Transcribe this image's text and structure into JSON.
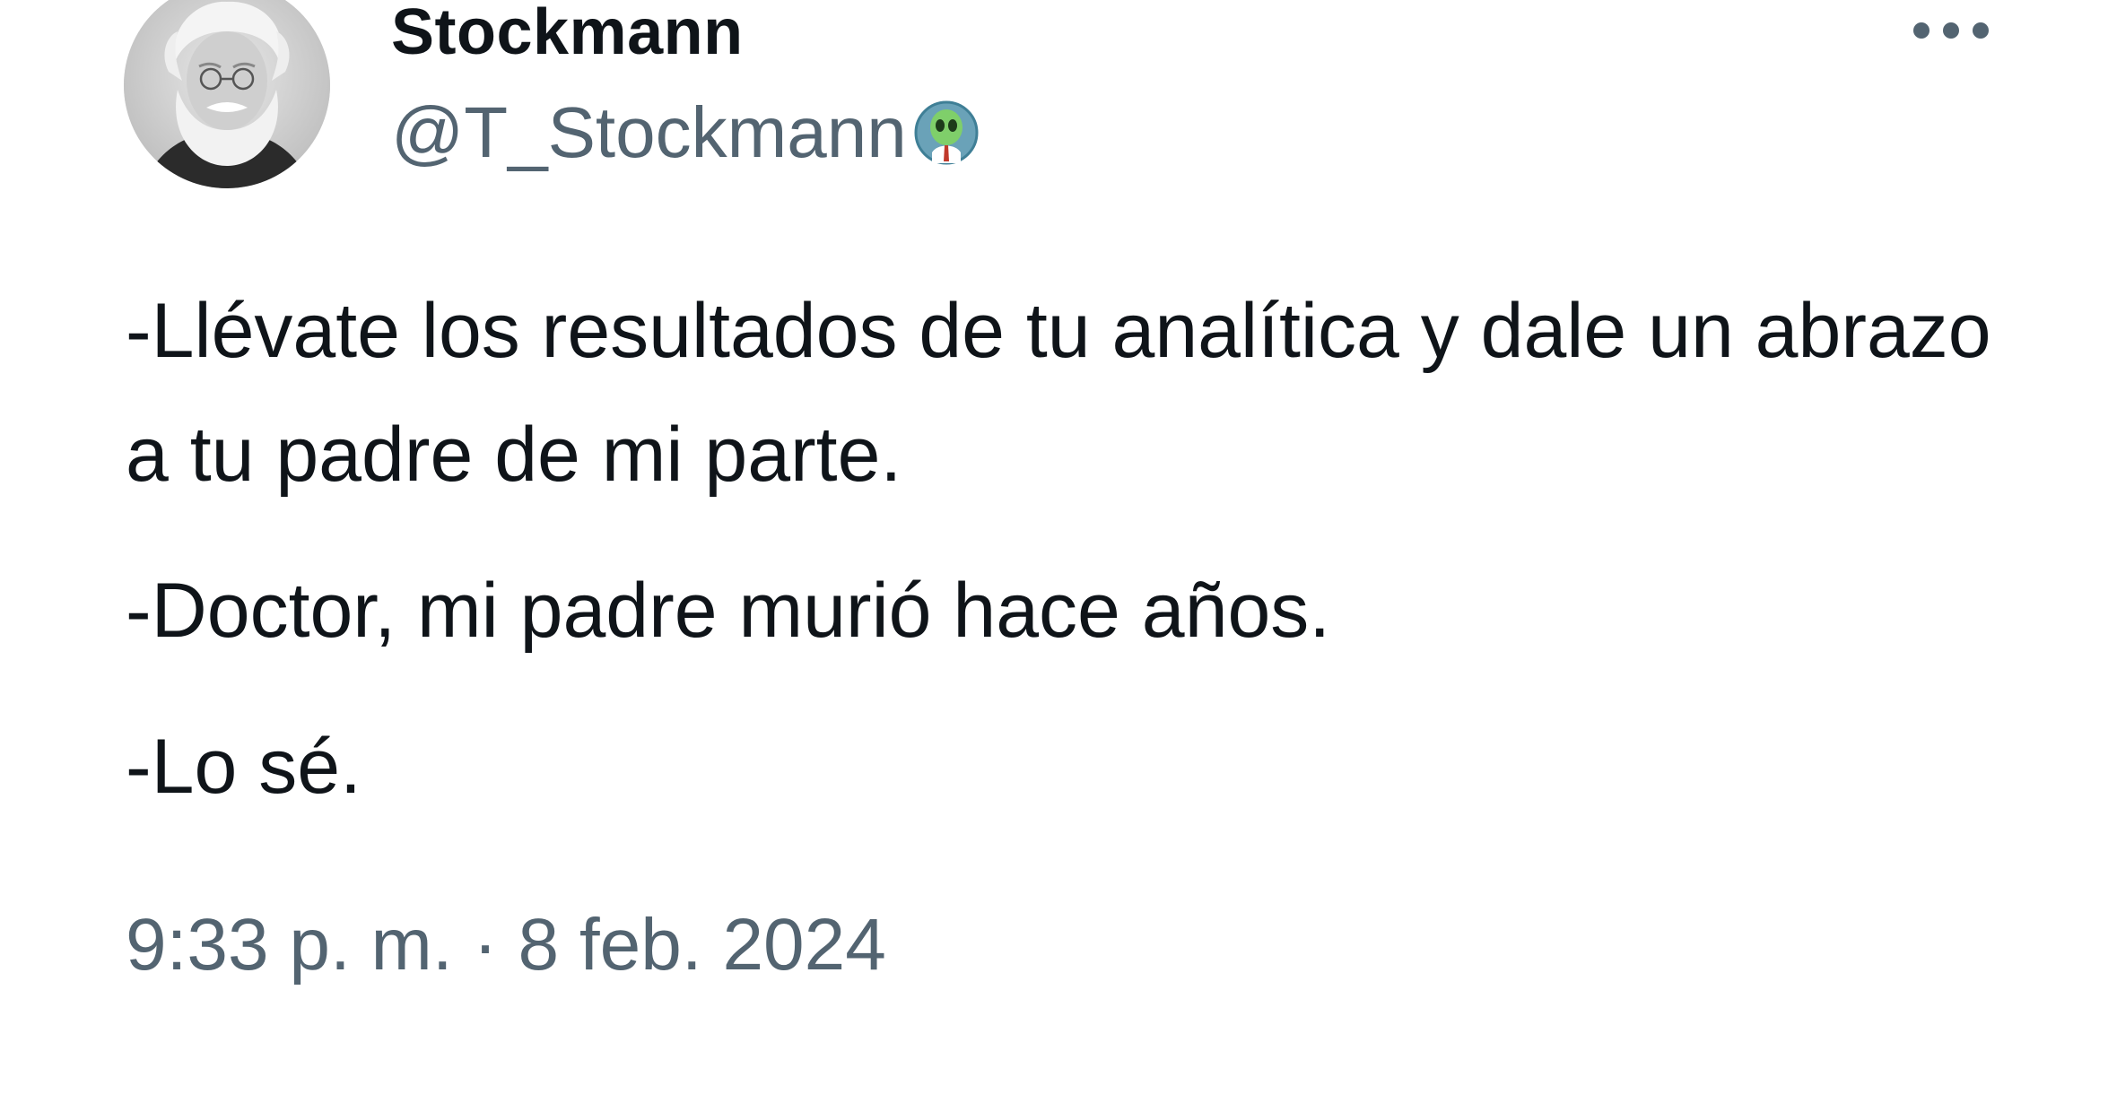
{
  "tweet": {
    "author": {
      "display_name": "Stockmann",
      "handle": "@T_Stockmann",
      "avatar_icon": "portrait-avatar",
      "badge_icon": "alien-emoji-badge-icon"
    },
    "more_icon": "more-options-icon",
    "paragraphs": [
      "-Llévate los resultados de tu analítica y dale un abrazo a tu padre de mi parte.",
      "-Doctor, mi padre murió hace años.",
      "-Lo sé."
    ],
    "timestamp": "9:33 p. m. · 8 feb. 2024"
  },
  "colors": {
    "text_primary": "#0f1419",
    "text_secondary": "#536471",
    "background": "#ffffff"
  }
}
